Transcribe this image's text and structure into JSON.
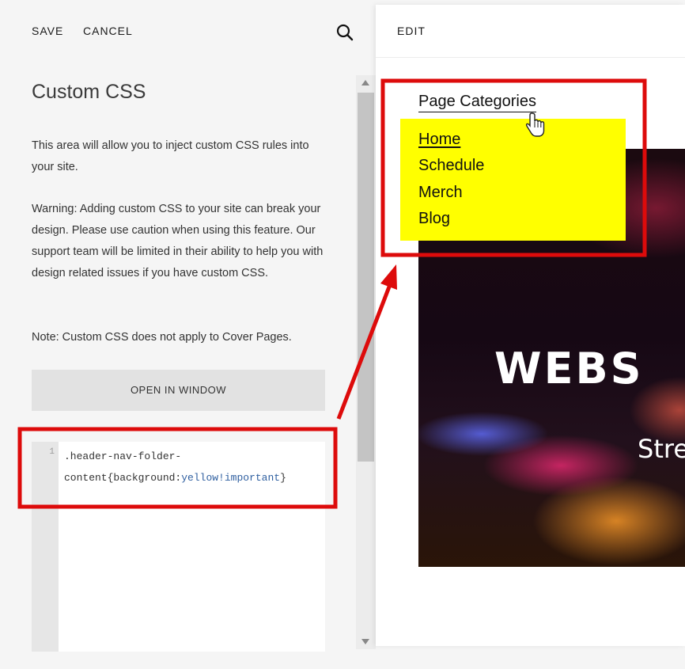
{
  "toolbar": {
    "save_label": "SAVE",
    "cancel_label": "CANCEL",
    "search_icon": "search-icon"
  },
  "panel": {
    "title": "Custom CSS",
    "description": "This area will allow you to inject custom CSS rules into your site.",
    "warning": "Warning: Adding custom CSS to your site can break your design. Please use caution when using this feature. Our support team will be limited in their ability to help you with design related issues if you have custom CSS.",
    "note": "Note: Custom CSS does not apply to Cover Pages.",
    "open_window_label": "OPEN IN WINDOW"
  },
  "editor": {
    "line_number": "1",
    "code_selector": ".header-nav-folder-",
    "code_prop": "content{background:",
    "code_value": "yellow!important",
    "code_close": "}"
  },
  "preview": {
    "edit_label": "EDIT",
    "folder_title": "Page Categories",
    "nav_links": [
      "Home",
      "Schedule",
      "Merch",
      "Blog"
    ],
    "hero_title": "WEBS",
    "hero_subtitle": "Stre"
  },
  "colors": {
    "highlight_red": "#dd0b0b",
    "folder_background": "#ffff00",
    "code_keyword": "#2f5fa0"
  }
}
